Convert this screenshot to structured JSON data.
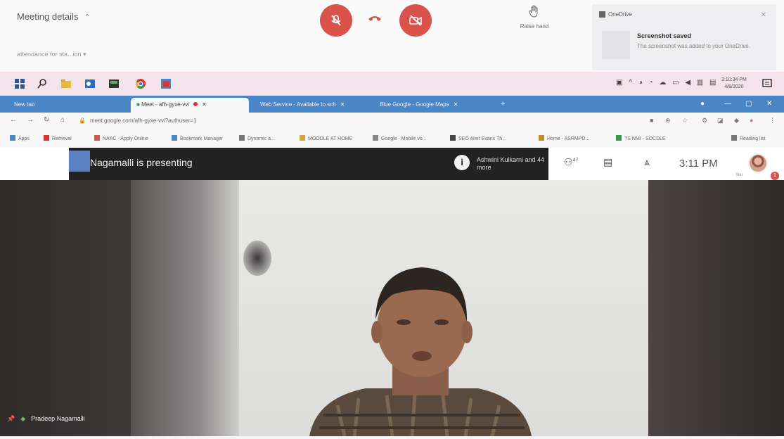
{
  "meeting_bar": {
    "details_label": "Meeting details",
    "attendance": "attendance for sta...ion",
    "raise_hand_label": "Raise hand"
  },
  "notification": {
    "app": "OneDrive",
    "title": "Screenshot saved",
    "body": "The screenshot was added to your OneDrive."
  },
  "taskbar": {
    "time": "3:10:34 PM",
    "date": "4/8/2020"
  },
  "tabs": [
    {
      "label": "New tab"
    },
    {
      "label": "Meet - afh-gyxe-vvi"
    },
    {
      "label": "Web Service - Available to sch"
    },
    {
      "label": "Blue Google - Google Maps"
    }
  ],
  "address": {
    "url": "meet.google.com/afh-gyxe-vvi?authuser=1"
  },
  "bookmarks": [
    {
      "label": "Apps",
      "color": "#4a86c5"
    },
    {
      "label": "Retrieval",
      "color": "#d33"
    },
    {
      "label": "NAAC - Apply Online",
      "color": "#c55"
    },
    {
      "label": "Bookmark Manager",
      "color": "#4a86c5"
    },
    {
      "label": "Dynamic a...",
      "color": "#777"
    },
    {
      "label": "MOODLE AT HOME",
      "color": "#d9a23a"
    },
    {
      "label": "Google - Mobile vo...",
      "color": "#888"
    },
    {
      "label": "SEO Alert Evans Th...",
      "color": "#444"
    },
    {
      "label": "Home - ASRMPD...",
      "color": "#c58a2a"
    },
    {
      "label": "TS NMI - SOCDLE",
      "color": "#3a9a4a"
    },
    {
      "label": "Reading list",
      "color": "#777"
    }
  ],
  "presentation": {
    "presenting_text": "Nagamalli is presenting",
    "presenter_sub": "Ashwini Kulkarni and 44 more"
  },
  "toolbar": {
    "participants_count": "47",
    "clock": "3:11 PM",
    "you_label": "You",
    "badge": "1"
  },
  "video": {
    "participant_name": "Pradeep Nagamalli"
  },
  "colors": {
    "end_call": "#d9534a",
    "tab_bar": "#4a86c5",
    "taskbar": "#f4e3ea"
  }
}
